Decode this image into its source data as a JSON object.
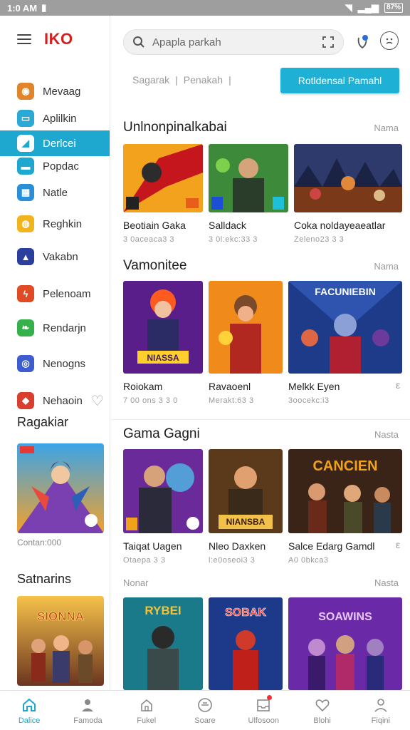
{
  "status": {
    "time": "1:0 AM",
    "battery": "87%"
  },
  "brand": "IKO",
  "sidebar": {
    "items": [
      {
        "label": "Mevaag",
        "icon": "owl-icon",
        "color": "#e0852c"
      },
      {
        "label": "Aplilkin",
        "icon": "chat-icon",
        "color": "#29a9d4"
      },
      {
        "label": "Derlcei",
        "icon": "cast-icon",
        "color": "#1fa8cf",
        "active": true
      },
      {
        "label": "Popdac",
        "icon": "folder-icon",
        "color": "#1fa8cf"
      },
      {
        "label": "Natle",
        "icon": "grid-icon",
        "color": "#2a8fd6"
      },
      {
        "label": "Reghkin",
        "icon": "coin-icon",
        "color": "#f2b41c"
      },
      {
        "label": "Vakabn",
        "icon": "ship-icon",
        "color": "#2c3e9e"
      },
      {
        "label": "Pelenoam",
        "icon": "bolt-icon",
        "color": "#e04a25"
      },
      {
        "label": "Rendarjn",
        "icon": "leaf-icon",
        "color": "#35b04a"
      },
      {
        "label": "Nenogns",
        "icon": "orbit-icon",
        "color": "#3d5ccf"
      },
      {
        "label": "Nehaoin",
        "icon": "cube-icon",
        "color": "#d93f2e"
      }
    ],
    "section1": {
      "title": "Ragakiar",
      "caption": "Contan:000"
    },
    "section2": {
      "title": "Satnarins"
    }
  },
  "header": {
    "search_placeholder": "Apapla parkah",
    "tabs_text": [
      "Sagarak",
      "|",
      "Penakah",
      "|"
    ],
    "cta_label": "Rotldensal Pamahl"
  },
  "sections": [
    {
      "title": "Unlnonpinalkabai",
      "more": "Nama",
      "cards": [
        {
          "title": "Beotiain Gaka",
          "sub": "3 0aceaca3 3"
        },
        {
          "title": "Salldack",
          "sub": "3 0l:ekc:33 3"
        },
        {
          "title": "Coka noldayeaeatlar",
          "sub": "Zeleno23 3 3"
        }
      ]
    },
    {
      "title": "Vamonitee",
      "more": "Nama",
      "cards": [
        {
          "title": "Roiokam",
          "sub": "7 00 ons 3 3 0"
        },
        {
          "title": "Ravaoenl",
          "sub": "Merakt:63 3"
        },
        {
          "title": "Melkk Eyen",
          "sub": "3oocekc:i3"
        }
      ],
      "dots": "ε"
    },
    {
      "title": "Gama Gagni",
      "more": "Nasta",
      "cards": [
        {
          "title": "Taiqat Uagen",
          "sub": "Otaepa 3 3"
        },
        {
          "title": "Nleo Daxken",
          "sub": "l:e0oseoi3 3"
        },
        {
          "title": "Salce Edarg Gamdl",
          "sub": "A0 0bkca3"
        }
      ],
      "dots": "ε"
    },
    {
      "title": "",
      "more": "Nasta",
      "left_label": "Nonar",
      "cards": [
        {
          "title": "",
          "sub": ""
        },
        {
          "title": "",
          "sub": ""
        },
        {
          "title": "",
          "sub": ""
        }
      ]
    }
  ],
  "thumb_text": {
    "s2c3": "FACUNIEBIN",
    "s2c1": "NIASSA",
    "s3c2": "NIANSBA",
    "s3c3": "CANCIEN",
    "s4c1": "RYBEI",
    "s4c2": "SOBAK",
    "s4c3": "SOAWINS",
    "side2": "SIONNA"
  },
  "bottom_nav": [
    {
      "label": "Dalice",
      "icon": "home-icon",
      "active": true
    },
    {
      "label": "Famoda",
      "icon": "person-icon"
    },
    {
      "label": "Fukel",
      "icon": "house-outline-icon"
    },
    {
      "label": "Soare",
      "icon": "compass-icon"
    },
    {
      "label": "Ulfosoon",
      "icon": "inbox-icon",
      "badge": true
    },
    {
      "label": "Blohi",
      "icon": "heart-icon"
    },
    {
      "label": "Fiqini",
      "icon": "profile-icon"
    }
  ]
}
